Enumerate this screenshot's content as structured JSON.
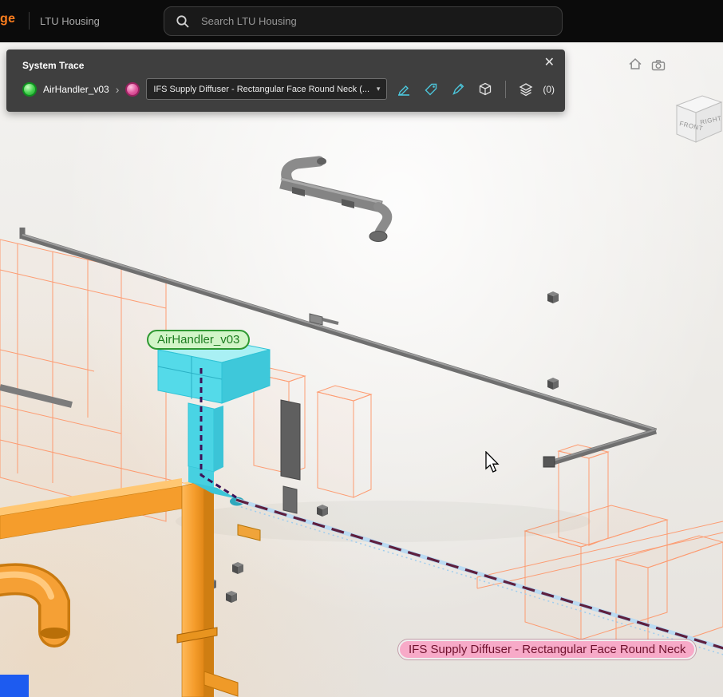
{
  "topbar": {
    "logo_fragment": "ge",
    "project_name": "LTU Housing",
    "search_placeholder": "Search LTU Housing"
  },
  "system_trace": {
    "title": "System Trace",
    "close_glyph": "✕",
    "source_label": "AirHandler_v03",
    "chevron_glyph": "›",
    "target_value": "IFS Supply Diffuser - Rectangular Face Round Neck (...",
    "caret_glyph": "▾",
    "layers_count": "(0)"
  },
  "scene_labels": {
    "air_handler": "AirHandler_v03",
    "diffuser": "IFS Supply Diffuser - Rectangular Face Round Neck"
  },
  "view_cube": {
    "front": "FRONT",
    "right": "RIGHT"
  },
  "colors": {
    "accent_teal": "#4cc5da",
    "selection_cyan": "#4fd6e6",
    "trace_maroon": "#5e1f3e",
    "duct_orange": "#f59d2c",
    "wireframe_orange": "#ff9466",
    "label_green_border": "#2f9932",
    "label_pink_bg": "#f7aac8",
    "corner_blue": "#1d5bf0"
  }
}
